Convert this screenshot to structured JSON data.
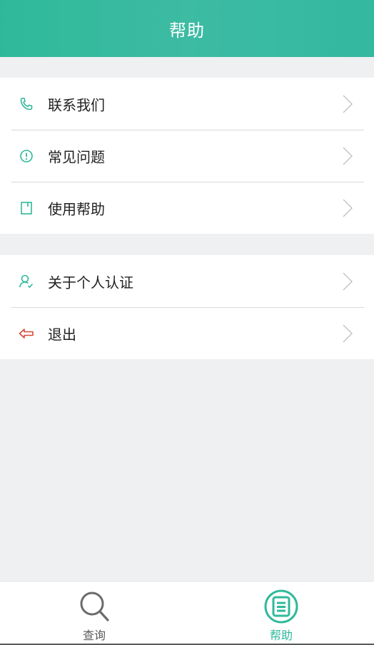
{
  "header": {
    "title": "帮助"
  },
  "groups": [
    {
      "items": [
        {
          "label": "联系我们",
          "icon": "phone-icon"
        },
        {
          "label": "常见问题",
          "icon": "exclamation-circle-icon"
        },
        {
          "label": "使用帮助",
          "icon": "book-icon"
        }
      ]
    },
    {
      "items": [
        {
          "label": "关于个人认证",
          "icon": "user-check-icon"
        },
        {
          "label": "退出",
          "icon": "logout-arrow-icon"
        }
      ]
    }
  ],
  "tabbar": {
    "tabs": [
      {
        "label": "查询",
        "icon": "search-icon",
        "active": false
      },
      {
        "label": "帮助",
        "icon": "list-circle-icon",
        "active": true
      }
    ]
  },
  "colors": {
    "accent": "#2fb99a",
    "logout": "#d64a3a",
    "background": "#eff0f2",
    "inactive": "#5b5b5b"
  }
}
